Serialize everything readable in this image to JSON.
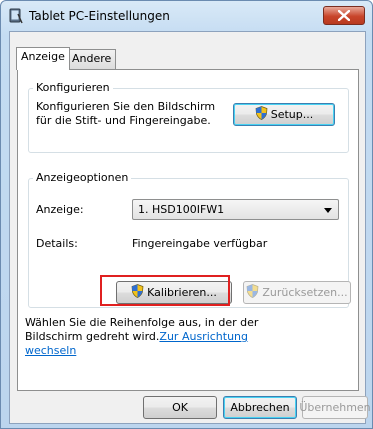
{
  "window": {
    "title": "Tablet PC-Einstellungen"
  },
  "tabs": [
    {
      "label": "Anzeige",
      "active": true
    },
    {
      "label": "Andere",
      "active": false
    }
  ],
  "configure": {
    "legend": "Konfigurieren",
    "line1": "Konfigurieren Sie den Bildschirm",
    "line2": "für die Stift- und Fingereingabe.",
    "setup_label": "Setup..."
  },
  "display_options": {
    "legend": "Anzeigeoptionen",
    "display_label": "Anzeige:",
    "display_value": "1. HSD100IFW1",
    "details_label": "Details:",
    "details_value": "Fingereingabe verfügbar",
    "calibrate_label": "Kalibrieren...",
    "reset_label": "Zurücksetzen..."
  },
  "orientation": {
    "line1": "Wählen Sie die Reihenfolge aus, in der der",
    "line2_prefix": "Bildschirm gedreht wird.",
    "link_part1": "Zur Ausrichtung",
    "link_part2": "wechseln"
  },
  "footer": {
    "ok_label": "OK",
    "cancel_label": "Abbrechen",
    "apply_label": "Übernehmen"
  },
  "colors": {
    "highlight": "#e02020",
    "link": "#0066cc",
    "close_button": "#c8452b"
  }
}
